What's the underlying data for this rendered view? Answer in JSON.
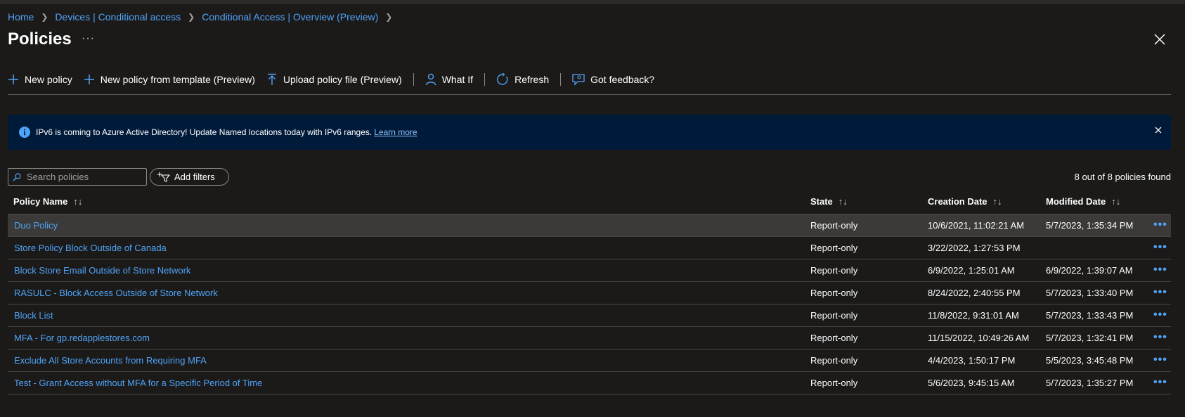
{
  "breadcrumb": {
    "items": [
      {
        "label": "Home"
      },
      {
        "label": "Devices | Conditional access"
      },
      {
        "label": "Conditional Access | Overview (Preview)"
      }
    ]
  },
  "page": {
    "title": "Policies",
    "more": "···"
  },
  "toolbar": {
    "new_policy": "New policy",
    "new_from_template": "New policy from template (Preview)",
    "upload": "Upload policy file (Preview)",
    "what_if": "What If",
    "refresh": "Refresh",
    "feedback": "Got feedback?"
  },
  "banner": {
    "text": "IPv6 is coming to Azure Active Directory! Update Named locations today with IPv6 ranges.",
    "link": "Learn more"
  },
  "search": {
    "placeholder": "Search policies",
    "value": ""
  },
  "filters": {
    "label": "Add filters"
  },
  "count": "8 out of 8 policies found",
  "table": {
    "columns": {
      "name": "Policy Name",
      "state": "State",
      "created": "Creation Date",
      "modified": "Modified Date",
      "sort_glyph": "↑↓"
    },
    "more_glyph": "•••",
    "rows": [
      {
        "name": "Duo Policy",
        "state": "Report-only",
        "created": "10/6/2021, 11:02:21 AM",
        "modified": "5/7/2023, 1:35:34 PM"
      },
      {
        "name": "Store Policy Block Outside of Canada",
        "state": "Report-only",
        "created": "3/22/2022, 1:27:53 PM",
        "modified": ""
      },
      {
        "name": "Block Store Email Outside of Store Network",
        "state": "Report-only",
        "created": "6/9/2022, 1:25:01 AM",
        "modified": "6/9/2022, 1:39:07 AM"
      },
      {
        "name": "RASULC - Block Access Outside of Store Network",
        "state": "Report-only",
        "created": "8/24/2022, 2:40:55 PM",
        "modified": "5/7/2023, 1:33:40 PM"
      },
      {
        "name": "Block List",
        "state": "Report-only",
        "created": "11/8/2022, 9:31:01 AM",
        "modified": "5/7/2023, 1:33:43 PM"
      },
      {
        "name": "MFA - For gp.redapplestores.com",
        "state": "Report-only",
        "created": "11/15/2022, 10:49:26 AM",
        "modified": "5/7/2023, 1:32:41 PM"
      },
      {
        "name": "Exclude All Store Accounts from Requiring MFA",
        "state": "Report-only",
        "created": "4/4/2023, 1:50:17 PM",
        "modified": "5/5/2023, 3:45:48 PM"
      },
      {
        "name": "Test - Grant Access without MFA for a Specific Period of Time",
        "state": "Report-only",
        "created": "5/6/2023, 9:45:15 AM",
        "modified": "5/7/2023, 1:35:27 PM"
      }
    ]
  },
  "colors": {
    "accent": "#4fa3f7",
    "background": "#1b1a19",
    "banner": "#001a3a",
    "selected_row": "#3b3a39"
  }
}
